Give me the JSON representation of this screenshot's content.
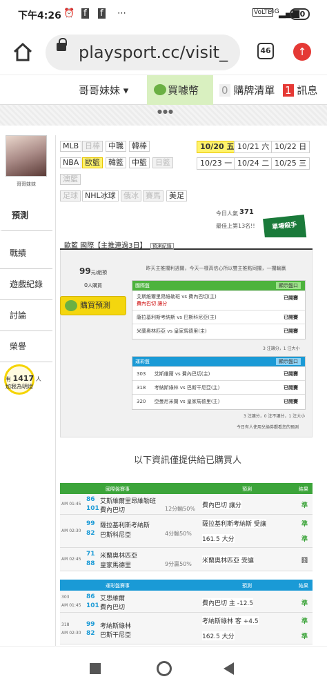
{
  "status": {
    "time": "下午4:26",
    "battery": "70",
    "network": "4G"
  },
  "browser": {
    "url": "playsport.cc/visit_",
    "tab_count": "46"
  },
  "topnav": {
    "user": "哥哥妹妹",
    "coins": "買噱幣",
    "cart_count": "0",
    "cart": "購牌清單",
    "msg_count": "1",
    "msg": "訊息"
  },
  "profile": {
    "name": "哥哥妹妹"
  },
  "sidebar": {
    "items": [
      "預測",
      "戰績",
      "遊戲紀錄",
      "討論",
      "榮譽"
    ]
  },
  "badge": {
    "prefix": "有",
    "count": "1417",
    "unit": "人",
    "text": "加我為明燈"
  },
  "leagues": [
    "MLB",
    "日棒",
    "中職",
    "韓棒",
    "NBA",
    "歐籃",
    "韓籃",
    "中籃",
    "日籃",
    "澳籃",
    "足球",
    "NHL冰球",
    "俄冰",
    "賽馬",
    "美足"
  ],
  "dates": [
    "10/20 五",
    "10/21 六",
    "10/22 日",
    "10/23 一",
    "10/24 二",
    "10/25 三"
  ],
  "popularity": {
    "label": "今日人氣",
    "value": "371",
    "rank": "最佳上第13名!!"
  },
  "panel": {
    "title": "歐籃 國際【主推連過3日】",
    "record": "預測紀錄",
    "price": "99",
    "price_unit": "元/組預",
    "buyers": "0",
    "buyers_unit": "人購買",
    "desc": "昨天主推擱利週關，今天一樣高信心所以雙主推點同擱，一擱輸贏",
    "buy": "購買預測",
    "section1": "國際盤",
    "section1_btn": "顯示盤口",
    "section1_rows": [
      {
        "game": "艾斯維爾里昂維勒班 vs 費內巴切(主)",
        "pick": "費內巴切 讓分",
        "status": "已開賽"
      },
      {
        "game": "薩拉基利斯考納斯 vs 巴斯科尼亞(主)",
        "pick": "",
        "status": "已開賽"
      },
      {
        "game": "米蘭奧林匹亞 vs 皇家馬德里(主)",
        "pick": "",
        "status": "已開賽"
      }
    ],
    "section1_note": "3 注讓分，1 注大小",
    "section2": "運彩盤",
    "section2_btn": "顯示盤口",
    "section2_rows": [
      {
        "num": "303",
        "game": "艾斯維爾 vs 費內巴切(主)",
        "status": "已開賽"
      },
      {
        "num": "318",
        "game": "考納斯綠林 vs 巴斯干尼亞(主)",
        "status": "已開賽"
      },
      {
        "num": "320",
        "game": "亞曼尼米蘭 vs 皇家馬德里(主)",
        "status": "已開賽"
      }
    ],
    "section2_note": "3 注讓分，0 注不讓分，1 注大小",
    "footer_note": "今日有人使用兌換券觀看您的預測"
  },
  "info_title": "以下資訊僅提供給已購買人",
  "intl_table": {
    "headers": [
      "國際盤賽事",
      "預測",
      "結果"
    ],
    "rows": [
      {
        "time": "AM 01:45",
        "s1": "86",
        "s2": "101",
        "t1": "艾斯維爾里昂維勒班",
        "t2": "費內巴切",
        "line": "12分輸50%",
        "pick": "費內巴切 讓分",
        "res": "準"
      },
      {
        "time": "AM 02:30",
        "s1": "99",
        "s2": "82",
        "t1": "薩拉基利斯考納斯",
        "t2": "巴斯科尼亞",
        "line": "4分輸50%",
        "pick": "薩拉基利斯考納斯 受讓",
        "pick2": "161.5 大分",
        "res": "準",
        "res2": "準"
      },
      {
        "time": "AM 02:45",
        "s1": "71",
        "s2": "88",
        "t1": "米蘭奧林匹亞",
        "t2": "皇家馬德里",
        "line": "9分贏50%",
        "pick": "米蘭奧林匹亞 受讓",
        "res": "囧"
      }
    ]
  },
  "lottery_table": {
    "headers": [
      "運彩盤賽事",
      "預測",
      "結果"
    ],
    "rows": [
      {
        "num": "303",
        "time": "AM 01:45",
        "s1": "86",
        "s2": "101",
        "t1": "艾思維爾",
        "t2": "費內巴切",
        "pick": "費內巴切 主 -12.5",
        "res": "準"
      },
      {
        "num": "318",
        "time": "AM 02:30",
        "s1": "99",
        "s2": "82",
        "t1": "考納斯綠林",
        "t2": "巴斯干尼亞",
        "pick": "考納斯綠林 客 +4.5",
        "pick2": "162.5 大分",
        "res": "準",
        "res2": "準"
      }
    ]
  },
  "colors": {
    "green": "#3ca43a",
    "blue": "#1a9ad6",
    "highlight": "#fff36b",
    "coin_bg": "#d9f0c0"
  }
}
